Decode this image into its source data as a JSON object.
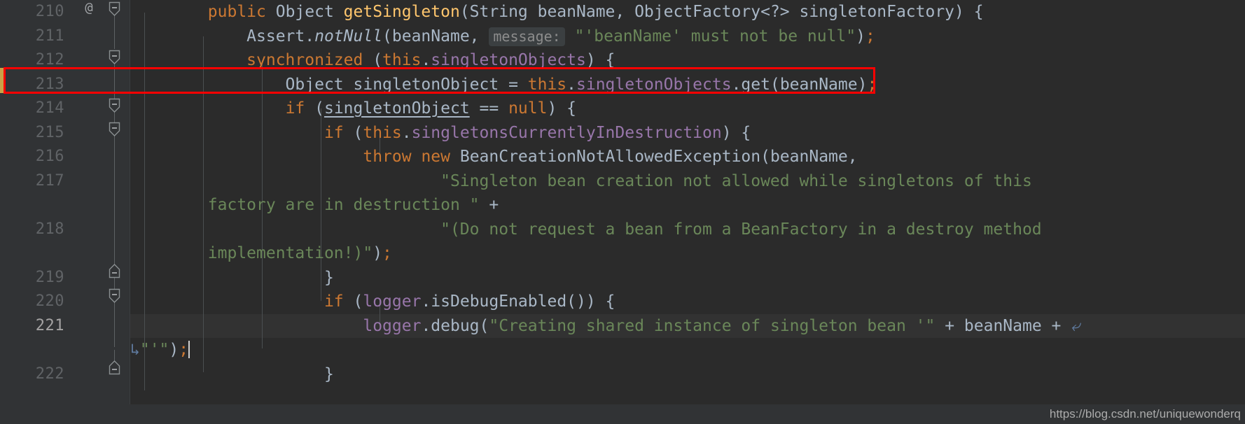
{
  "app": {
    "kind": "code-editor",
    "theme": "Darcula",
    "language": "Java",
    "background": "#2b2b2b",
    "gutter_background": "#313335",
    "accent_highlight": "#ff0000"
  },
  "colors": {
    "keyword": "#cc7832",
    "string": "#6a8759",
    "field": "#9876aa",
    "method_declaration": "#ffc66d",
    "default_text": "#a9b7c6",
    "line_number": "#606366",
    "line_number_current": "#a4a3a3",
    "inlay_hint_bg": "#3b3f41",
    "inlay_hint_fg": "#8c8c8c",
    "change_marker": "#c9a247",
    "soft_wrap_arrow": "#5f7a9e",
    "annotation_box": "#ff0000"
  },
  "gutter": {
    "line_numbers": [
      "210",
      "211",
      "212",
      "213",
      "214",
      "215",
      "216",
      "217",
      "218",
      "219",
      "220",
      "221",
      "222"
    ],
    "current_line_number": "221",
    "override_marker": "@",
    "fold_marker_glyph": "−",
    "change_marker_lines": [
      "213"
    ]
  },
  "code_lines": [
    {
      "number": "210",
      "tokens": [
        {
          "t": "        ",
          "c": "plain"
        },
        {
          "t": "public",
          "c": "keyword"
        },
        {
          "t": " Object ",
          "c": "plain"
        },
        {
          "t": "getSingleton",
          "c": "method"
        },
        {
          "t": "(String beanName, ObjectFactory<?> singletonFactory) {",
          "c": "plain"
        }
      ]
    },
    {
      "number": "211",
      "tokens": [
        {
          "t": "            Assert.",
          "c": "plain"
        },
        {
          "t": "notNull",
          "c": "italic"
        },
        {
          "t": "(beanName, ",
          "c": "plain"
        },
        {
          "t": "message:",
          "c": "hint"
        },
        {
          "t": " ",
          "c": "plain"
        },
        {
          "t": "\"'beanName' must not be null\"",
          "c": "string"
        },
        {
          "t": ")",
          "c": "plain"
        },
        {
          "t": ";",
          "c": "semicolon"
        }
      ]
    },
    {
      "number": "212",
      "tokens": [
        {
          "t": "            ",
          "c": "plain"
        },
        {
          "t": "synchronized",
          "c": "keyword"
        },
        {
          "t": " (",
          "c": "plain"
        },
        {
          "t": "this",
          "c": "keyword"
        },
        {
          "t": ".",
          "c": "plain"
        },
        {
          "t": "singletonObjects",
          "c": "field"
        },
        {
          "t": ") {",
          "c": "plain"
        }
      ]
    },
    {
      "number": "213",
      "highlighted": true,
      "tokens": [
        {
          "t": "                Object ",
          "c": "plain"
        },
        {
          "t": "singletonObject",
          "c": "underlined"
        },
        {
          "t": " = ",
          "c": "plain"
        },
        {
          "t": "this",
          "c": "keyword"
        },
        {
          "t": ".",
          "c": "plain"
        },
        {
          "t": "singletonObjects",
          "c": "field"
        },
        {
          "t": ".get(beanName)",
          "c": "plain"
        },
        {
          "t": ";",
          "c": "semicolon"
        }
      ]
    },
    {
      "number": "214",
      "tokens": [
        {
          "t": "                ",
          "c": "plain"
        },
        {
          "t": "if",
          "c": "keyword"
        },
        {
          "t": " (",
          "c": "plain"
        },
        {
          "t": "singletonObject",
          "c": "underlined"
        },
        {
          "t": " == ",
          "c": "plain"
        },
        {
          "t": "null",
          "c": "keyword"
        },
        {
          "t": ") {",
          "c": "plain"
        }
      ]
    },
    {
      "number": "215",
      "tokens": [
        {
          "t": "                    ",
          "c": "plain"
        },
        {
          "t": "if",
          "c": "keyword"
        },
        {
          "t": " (",
          "c": "plain"
        },
        {
          "t": "this",
          "c": "keyword"
        },
        {
          "t": ".",
          "c": "plain"
        },
        {
          "t": "singletonsCurrentlyInDestruction",
          "c": "field"
        },
        {
          "t": ") {",
          "c": "plain"
        }
      ]
    },
    {
      "number": "216",
      "tokens": [
        {
          "t": "                        ",
          "c": "plain"
        },
        {
          "t": "throw",
          "c": "keyword"
        },
        {
          "t": " ",
          "c": "plain"
        },
        {
          "t": "new",
          "c": "keyword"
        },
        {
          "t": " BeanCreationNotAllowedException(beanName,",
          "c": "plain"
        }
      ]
    },
    {
      "number": "217",
      "wrapped": true,
      "tokens": [
        {
          "t": "                                ",
          "c": "plain"
        },
        {
          "t": "\"Singleton bean creation not allowed while singletons of this",
          "c": "string"
        }
      ],
      "wrap_tokens": [
        {
          "t": "        ",
          "c": "plain"
        },
        {
          "t": "factory are in destruction \"",
          "c": "string"
        },
        {
          "t": " +",
          "c": "plain"
        }
      ]
    },
    {
      "number": "218",
      "wrapped": true,
      "tokens": [
        {
          "t": "                                ",
          "c": "plain"
        },
        {
          "t": "\"(Do not request a bean from a BeanFactory in a destroy method",
          "c": "string"
        }
      ],
      "wrap_tokens": [
        {
          "t": "        ",
          "c": "plain"
        },
        {
          "t": "implementation!)\"",
          "c": "string"
        },
        {
          "t": ")",
          "c": "plain"
        },
        {
          "t": ";",
          "c": "semicolon"
        }
      ]
    },
    {
      "number": "219",
      "tokens": [
        {
          "t": "                    }",
          "c": "plain"
        }
      ]
    },
    {
      "number": "220",
      "tokens": [
        {
          "t": "                    ",
          "c": "plain"
        },
        {
          "t": "if",
          "c": "keyword"
        },
        {
          "t": " (",
          "c": "plain"
        },
        {
          "t": "logger",
          "c": "field"
        },
        {
          "t": ".isDebugEnabled()) {",
          "c": "plain"
        }
      ]
    },
    {
      "number": "221",
      "current": true,
      "wrapped": true,
      "tokens": [
        {
          "t": "                        ",
          "c": "plain"
        },
        {
          "t": "logger",
          "c": "field"
        },
        {
          "t": ".debug(",
          "c": "plain"
        },
        {
          "t": "\"Creating shared instance of singleton bean '\"",
          "c": "string"
        },
        {
          "t": " + beanName + ",
          "c": "plain"
        }
      ],
      "wrap_tokens": [
        {
          "t": "\"'\"",
          "c": "string"
        },
        {
          "t": ")",
          "c": "plain"
        },
        {
          "t": ";",
          "c": "semicolon"
        }
      ]
    },
    {
      "number": "222",
      "tokens": [
        {
          "t": "                    }",
          "c": "plain"
        }
      ]
    }
  ],
  "annotation": {
    "type": "red-rectangle",
    "target_line": "213",
    "label": ""
  },
  "watermark": {
    "text": "https://blog.csdn.net/uniquewonderq"
  }
}
